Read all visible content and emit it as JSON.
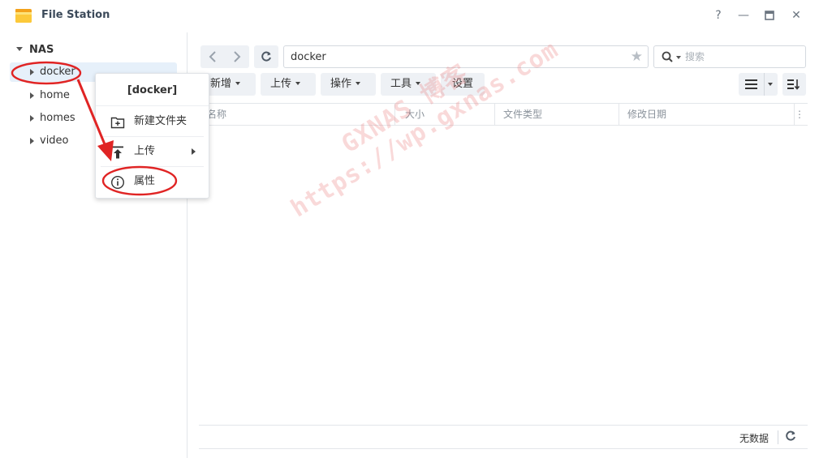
{
  "window": {
    "title": "File Station",
    "help": "?",
    "minimize": "—",
    "maximize": "▭",
    "close": "✕"
  },
  "sidebar": {
    "root": "NAS",
    "items": [
      {
        "label": "docker",
        "selected": true
      },
      {
        "label": "home",
        "selected": false
      },
      {
        "label": "homes",
        "selected": false
      },
      {
        "label": "video",
        "selected": false
      }
    ]
  },
  "toolbar": {
    "path": "docker",
    "search_placeholder": "搜索",
    "buttons": [
      {
        "label": "新增",
        "dropdown": true
      },
      {
        "label": "上传",
        "dropdown": true
      },
      {
        "label": "操作",
        "dropdown": true
      },
      {
        "label": "工具",
        "dropdown": true
      },
      {
        "label": "设置",
        "dropdown": false
      }
    ]
  },
  "table": {
    "columns": [
      "名称",
      "大小",
      "文件类型",
      "修改日期"
    ]
  },
  "footer": {
    "status": "无数据"
  },
  "context_menu": {
    "title": "[docker]",
    "items": [
      {
        "label": "新建文件夹",
        "icon": "new-folder-icon",
        "submenu": false
      },
      {
        "label": "上传",
        "icon": "upload-icon",
        "submenu": true
      },
      {
        "label": "属性",
        "icon": "info-icon",
        "submenu": false
      }
    ]
  },
  "watermark": {
    "line1": "GXNAS 博客",
    "line2": "https://wp.gxnas.com"
  },
  "colors": {
    "selection": "#e6f0fa",
    "annotation_red": "#e02424",
    "button_bg": "#eef1f5"
  }
}
